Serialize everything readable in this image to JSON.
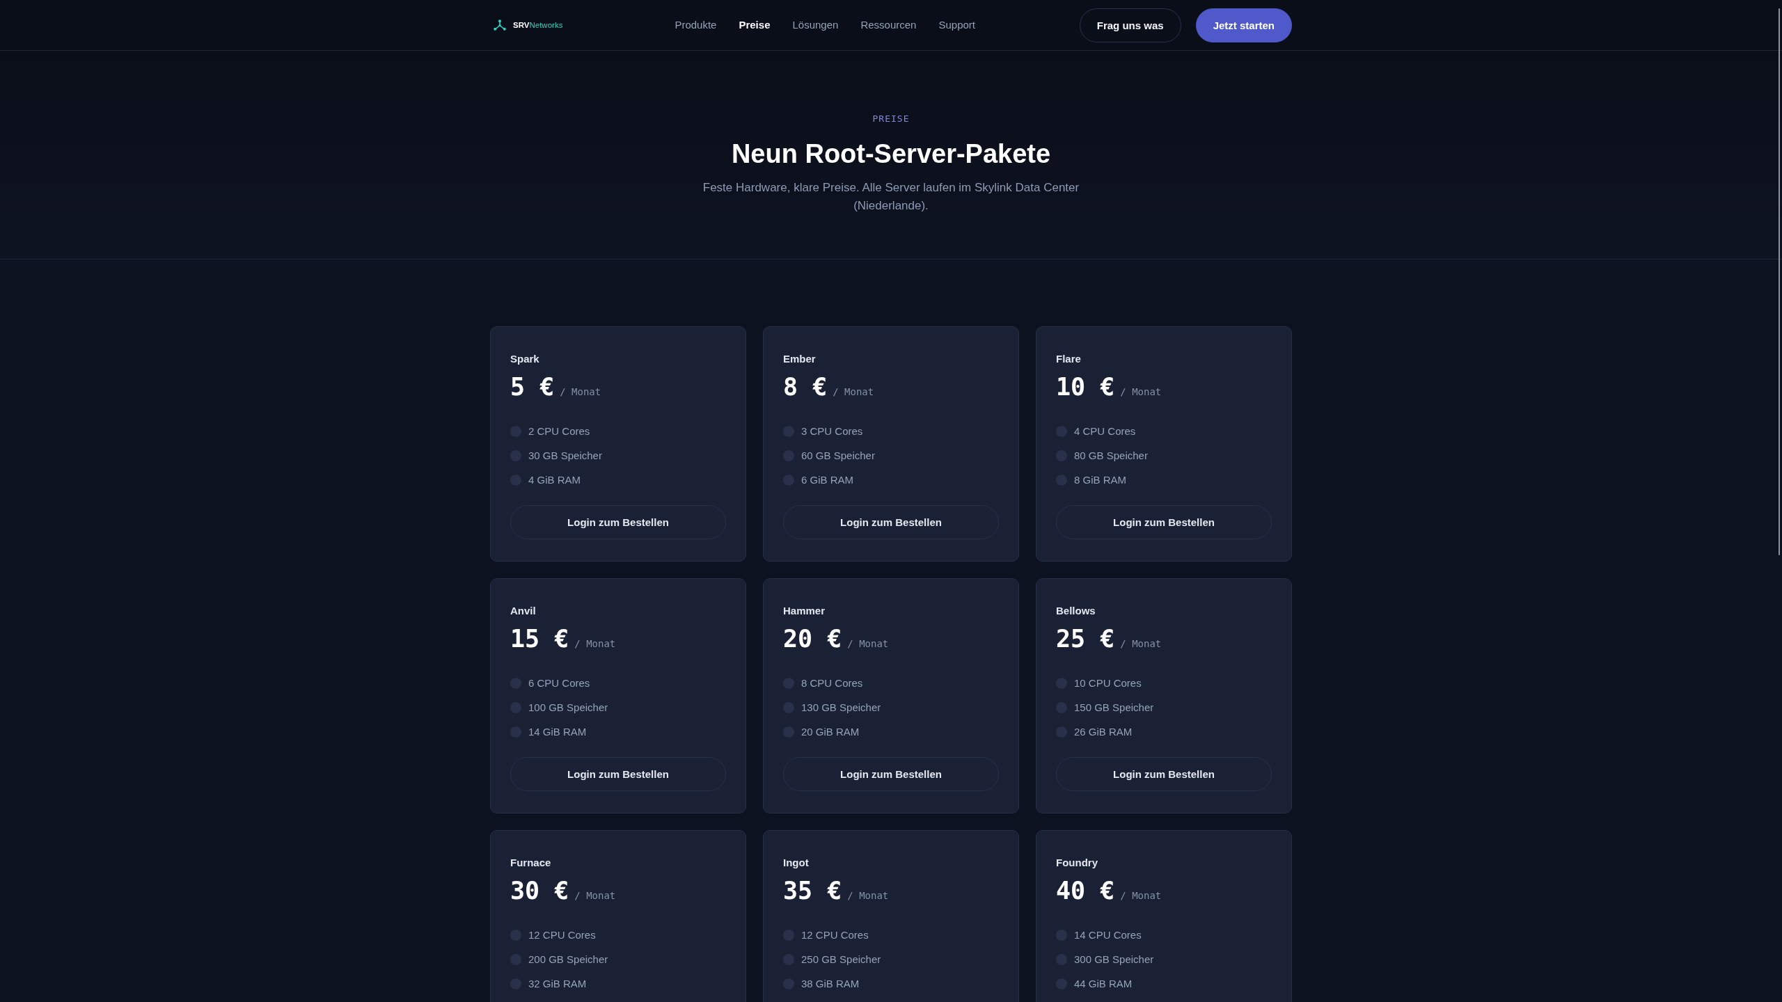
{
  "header": {
    "logo": "**SRV**Networks",
    "nav": [
      {
        "label": "Produkte",
        "selected": false
      },
      {
        "label": "Preise",
        "selected": true
      },
      {
        "label": "Lösungen",
        "selected": false
      },
      {
        "label": "Ressourcen",
        "selected": false
      },
      {
        "label": "Support",
        "selected": false
      }
    ],
    "actions": [
      {
        "label": "Frag uns was",
        "kind": "outline"
      },
      {
        "label": "Jetzt starten",
        "kind": "primary"
      }
    ]
  },
  "hero": {
    "eyebrow": "PREISE",
    "title": "Neun Root-Server-Pakete",
    "subtitle": "Feste Hardware, klare Preise. Alle Server laufen im Skylink Data Center (Niederlande)."
  },
  "plans": [
    {
      "name": "Spark",
      "price": "5 €",
      "period": "/ Monat",
      "features": [
        "2 CPU Cores",
        "30 GB Speicher",
        "4 GiB RAM"
      ],
      "button": "Login zum Bestellen"
    },
    {
      "name": "Ember",
      "price": "8 €",
      "period": "/ Monat",
      "features": [
        "3 CPU Cores",
        "60 GB Speicher",
        "6 GiB RAM"
      ],
      "button": "Login zum Bestellen"
    },
    {
      "name": "Flare",
      "price": "10 €",
      "period": "/ Monat",
      "features": [
        "4 CPU Cores",
        "80 GB Speicher",
        "8 GiB RAM"
      ],
      "button": "Login zum Bestellen"
    },
    {
      "name": "Anvil",
      "price": "15 €",
      "period": "/ Monat",
      "features": [
        "6 CPU Cores",
        "100 GB Speicher",
        "14 GiB RAM"
      ],
      "button": "Login zum Bestellen"
    },
    {
      "name": "Hammer",
      "price": "20 €",
      "period": "/ Monat",
      "features": [
        "8 CPU Cores",
        "130 GB Speicher",
        "20 GiB RAM"
      ],
      "button": "Login zum Bestellen"
    },
    {
      "name": "Bellows",
      "price": "25 €",
      "period": "/ Monat",
      "features": [
        "10 CPU Cores",
        "150 GB Speicher",
        "26 GiB RAM"
      ],
      "button": "Login zum Bestellen"
    },
    {
      "name": "Furnace",
      "price": "30 €",
      "period": "/ Monat",
      "features": [
        "12 CPU Cores",
        "200 GB Speicher",
        "32 GiB RAM"
      ]
    },
    {
      "name": "Ingot",
      "price": "35 €",
      "period": "/ Monat",
      "features": [
        "12 CPU Cores",
        "250 GB Speicher",
        "38 GiB RAM"
      ]
    },
    {
      "name": "Foundry",
      "price": "40 €",
      "period": "/ Monat",
      "features": [
        "14 CPU Cores",
        "300 GB Speicher",
        "44 GiB RAM"
      ]
    }
  ]
}
